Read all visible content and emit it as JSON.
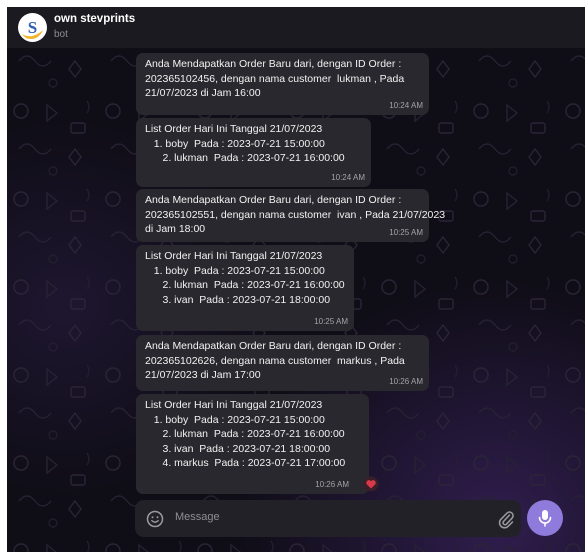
{
  "chat": {
    "title": "own stevprints",
    "subtitle": "bot"
  },
  "messages": [
    {
      "lines": [
        "Anda Mendapatkan Order Baru dari, dengan ID Order :",
        "202365102456, dengan nama customer  lukman , Pada",
        "21/07/2023 di Jam 16:00"
      ],
      "time": "10:24 AM"
    },
    {
      "lines": [
        "List Order Hari Ini Tanggal 21/07/2023",
        "",
        "   1. boby  Pada : 2023-07-21 15:00:00",
        "      2. lukman  Pada : 2023-07-21 16:00:00"
      ],
      "time": "10:24 AM"
    },
    {
      "lines": [
        "Anda Mendapatkan Order Baru dari, dengan ID Order :",
        "202365102551, dengan nama customer  ivan , Pada 21/07/2023",
        "di Jam 18:00"
      ],
      "time": "10:25 AM"
    },
    {
      "lines": [
        "List Order Hari Ini Tanggal 21/07/2023",
        "",
        "   1. boby  Pada : 2023-07-21 15:00:00",
        "      2. lukman  Pada : 2023-07-21 16:00:00",
        "      3. ivan  Pada : 2023-07-21 18:00:00"
      ],
      "time": "10:25 AM"
    },
    {
      "lines": [
        "Anda Mendapatkan Order Baru dari, dengan ID Order :",
        "202365102626, dengan nama customer  markus , Pada",
        "21/07/2023 di Jam 17:00"
      ],
      "time": "10:26 AM"
    },
    {
      "lines": [
        "List Order Hari Ini Tanggal 21/07/2023",
        "",
        "   1. boby  Pada : 2023-07-21 15:00:00",
        "      2. lukman  Pada : 2023-07-21 16:00:00",
        "      3. ivan  Pada : 2023-07-21 18:00:00",
        "      4. markus  Pada : 2023-07-21 17:00:00"
      ],
      "time": "10:26 AM",
      "reaction": "heart"
    }
  ],
  "composer": {
    "placeholder": "Message"
  },
  "icons": {
    "avatar": "stevprints-logo",
    "emoji": "smiley-icon",
    "attach": "paperclip-icon",
    "send": "microphone-icon"
  },
  "colors": {
    "background": "#0f0d16",
    "header": "#1b1a20",
    "bubble": "#2a282f",
    "accent": "#8f7bdc",
    "reaction": "#d93a4b"
  }
}
